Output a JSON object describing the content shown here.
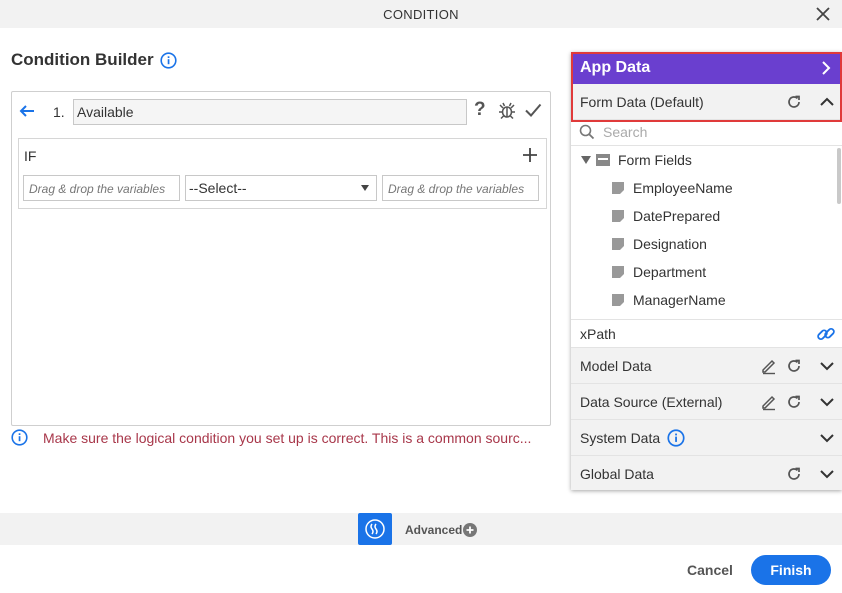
{
  "window": {
    "title": "CONDITION"
  },
  "builder": {
    "title": "Condition Builder",
    "rule_number": "1.",
    "rule_name": "Available",
    "help_label": "?",
    "if_label": "IF",
    "left_operand_placeholder": "Drag & drop the variables",
    "operator_selected": "--Select--",
    "right_operand_placeholder": "Drag & drop the variables",
    "warning": "Make sure the logical condition you set up is correct. This is a common sourc..."
  },
  "app_data": {
    "title": "App Data",
    "form_data_label": "Form Data (Default)",
    "search_placeholder": "Search",
    "form_fields_label": "Form Fields",
    "fields": [
      "EmployeeName",
      "DatePrepared",
      "Designation",
      "Department",
      "ManagerName"
    ],
    "xpath_label": "xPath",
    "sections": [
      {
        "label": "Model Data"
      },
      {
        "label": "Data Source (External)"
      },
      {
        "label": "System Data"
      },
      {
        "label": "Global Data"
      }
    ]
  },
  "footer": {
    "advanced_label": "Advanced",
    "cancel_label": "Cancel",
    "finish_label": "Finish"
  },
  "colors": {
    "accent_blue": "#1a73e8",
    "app_data_purple": "#6a3fcf",
    "warning_red": "#a8374a",
    "highlight_red": "#e03a3a"
  },
  "icons": [
    "close-icon",
    "info-icon",
    "back-arrow-icon",
    "bug-icon",
    "check-icon",
    "plus-icon",
    "chevron-right-icon",
    "refresh-icon",
    "chevron-up-icon",
    "chevron-down-icon",
    "edit-icon",
    "search-icon",
    "folder-icon",
    "field-icon",
    "link-icon",
    "advanced-icon",
    "plus-circle-icon"
  ]
}
